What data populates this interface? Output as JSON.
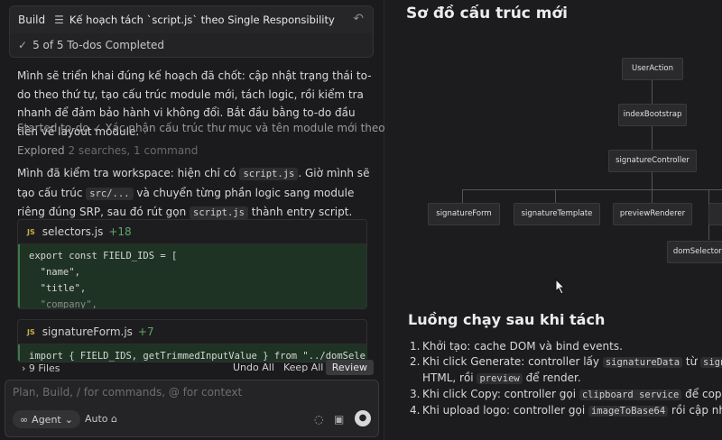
{
  "left": {
    "header": {
      "mode": "Build",
      "title": "Kế hoạch tách `script.js` theo Single Responsibility",
      "undo_icon": "undo-icon"
    },
    "todo_status": "5 of 5 To-dos Completed",
    "intro": "Mình sẽ triển khai đúng kế hoạch đã chốt: cập nhật trạng thái to-do theo thứ tự, tạo cấu trúc module mới, tách logic, rồi kiểm tra nhanh để đảm bảo hành vi không đổi. Bắt đầu bằng to-do đầu tiên về layout module.",
    "started": {
      "label": "Started to-do",
      "text": "Xác nhận cấu trúc thư mục và tên module mới theo SRP."
    },
    "explored": {
      "label": "Explored",
      "detail": "2 searches, 1 command"
    },
    "workspace": {
      "p1": "Mình đã kiểm tra workspace: hiện chỉ có",
      "c1": "script.js",
      "p2": ". Giờ mình sẽ tạo cấu trúc",
      "c2": "src/...",
      "p3": "và chuyển từng phần logic sang module riêng đúng SRP, sau đó rút gọn",
      "c3": "script.js",
      "p4": "thành entry script."
    },
    "files": [
      {
        "badge": "JS",
        "name": "selectors.js",
        "added": "+18",
        "lines": [
          "export const FIELD_IDS = [",
          "  \"name\",",
          "  \"title\",",
          "  \"company\","
        ]
      },
      {
        "badge": "JS",
        "name": "signatureForm.js",
        "added": "+7",
        "lines": [
          "import { FIELD_IDS, getTrimmedInputValue } from \"../domSelecto"
        ]
      }
    ],
    "bottom": {
      "files": "9 Files",
      "undo_all": "Undo All",
      "keep_all": "Keep All",
      "review": "Review"
    },
    "input": {
      "placeholder": "Plan, Build, / for commands, @ for context",
      "agent": "Agent",
      "auto": "Auto"
    }
  },
  "right": {
    "title": "Sơ đồ cấu trúc mới",
    "nodes": {
      "n1": "UserAction",
      "n2": "indexBootstrap",
      "n3": "signatureController",
      "n4": "signatureForm",
      "n5": "signatureTemplate",
      "n6": "previewRenderer",
      "n7": "domSelectors"
    },
    "subtitle": "Luồng chạy sau khi tách",
    "list": {
      "i1": "Khởi tạo: cache DOM và bind events.",
      "i2a": "Khi click Generate: controller lấy",
      "i2b": "signatureData",
      "i2c": "từ",
      "i2d": "signatureFo",
      "i2e": "HTML, rồi",
      "i2f": "preview",
      "i2g": "để render.",
      "i3a": "Khi click Copy: controller gọi",
      "i3b": "clipboard service",
      "i3c": "để copy từ ou",
      "i4a": "Khi upload logo: controller gọi",
      "i4b": "imageToBase64",
      "i4c": "rồi cập nhật inpu"
    }
  }
}
